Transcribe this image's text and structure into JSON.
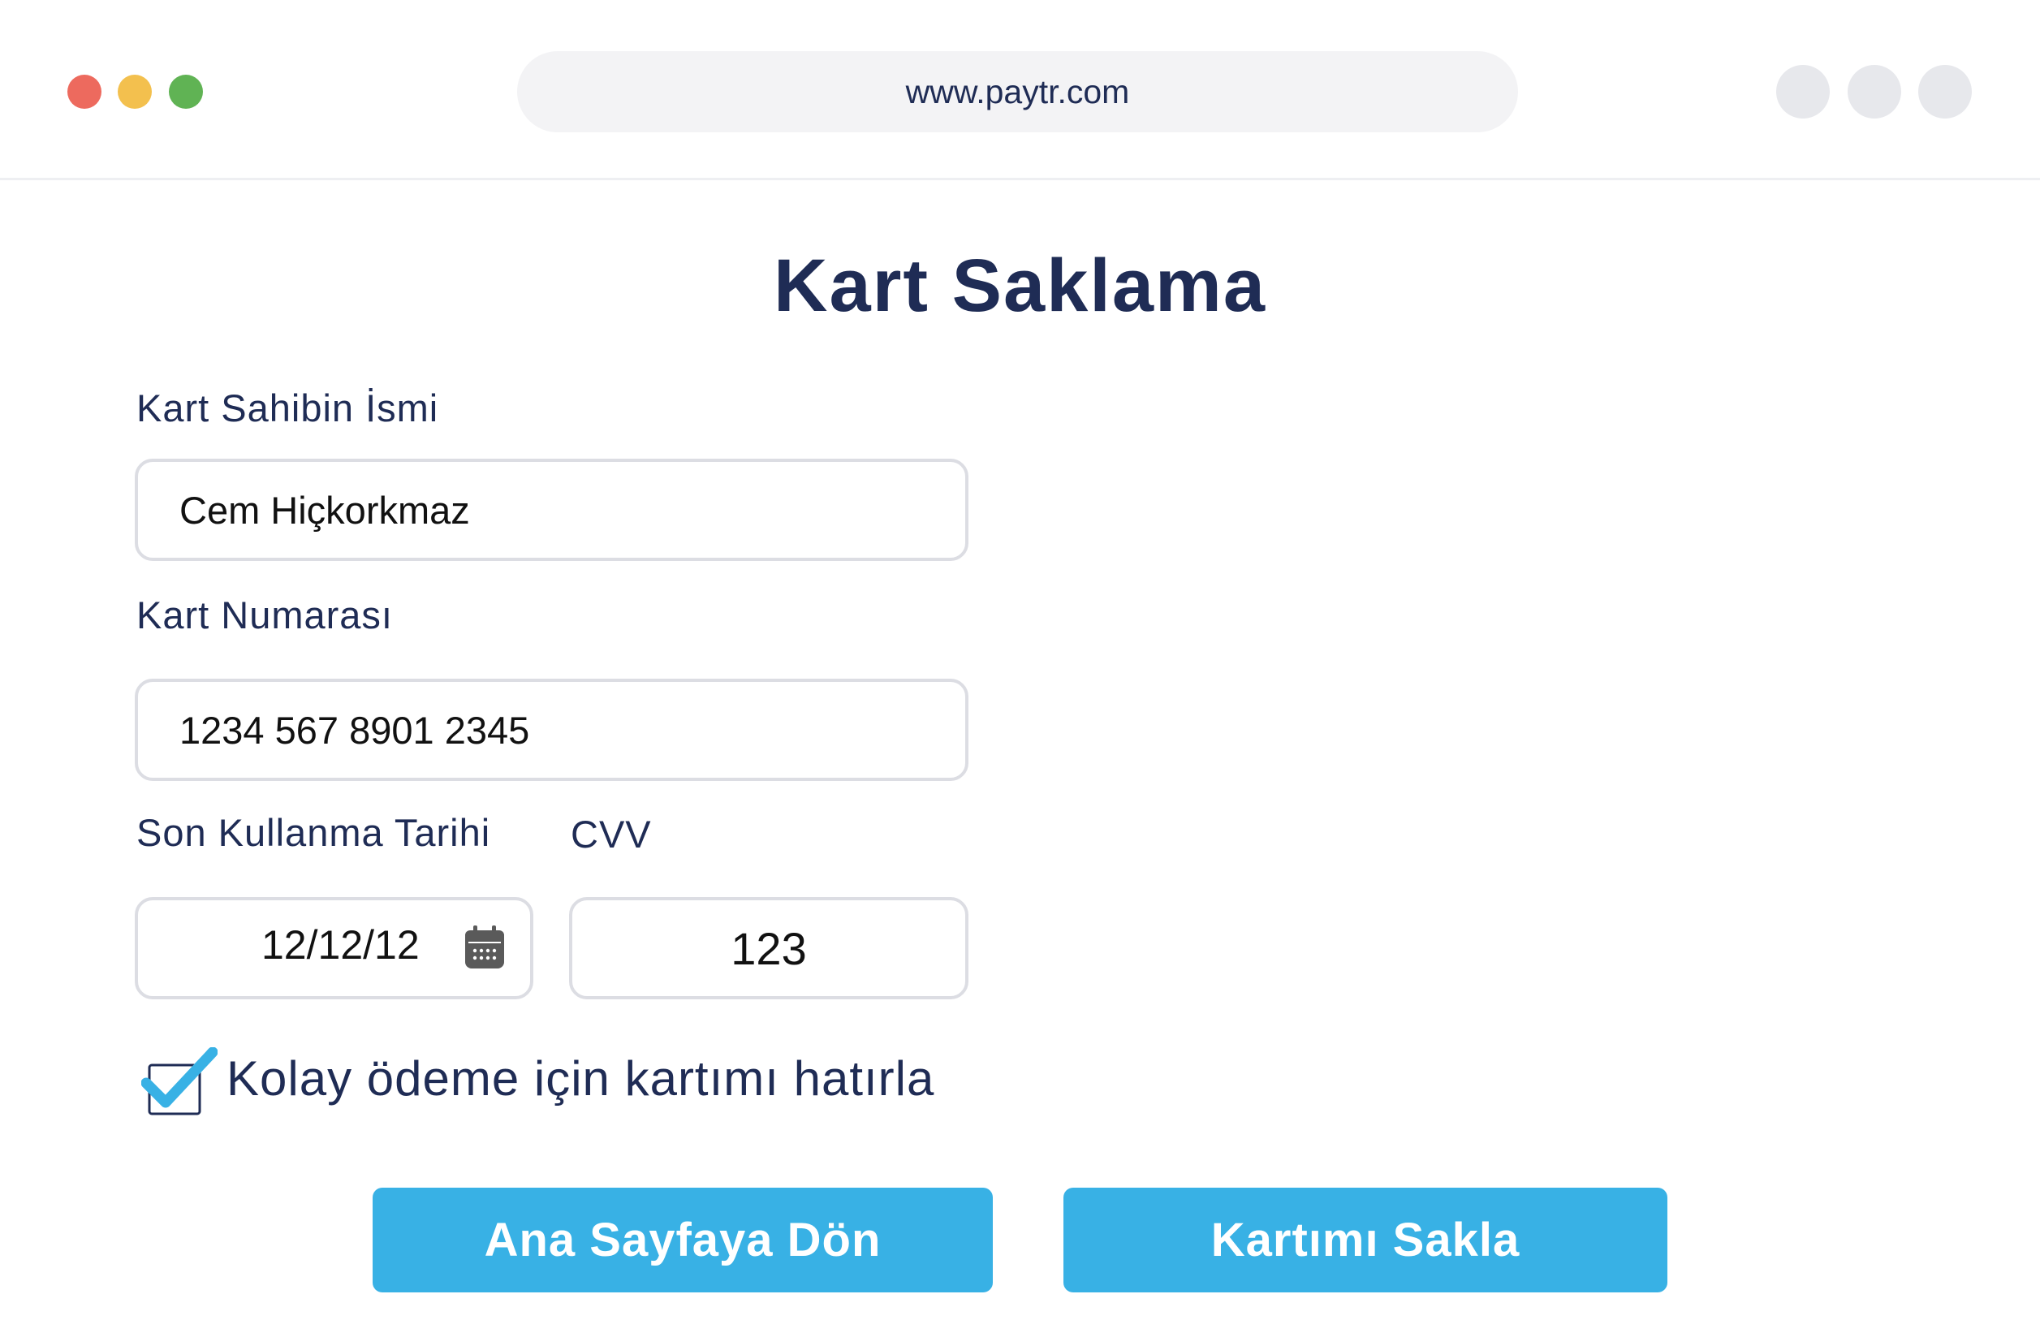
{
  "browser": {
    "url": "www.paytr.com"
  },
  "page": {
    "title": "Kart Saklama"
  },
  "form": {
    "name_label": "Kart Sahibin İsmi",
    "name_value": "Cem Hiçkorkmaz",
    "number_label": "Kart Numarası",
    "number_value": "1234 567 8901 2345",
    "expiry_label": "Son Kullanma Tarihi",
    "expiry_value": "12/12/12",
    "cvv_label": "CVV",
    "cvv_value": "123",
    "remember_label": "Kolay ödeme için kartımı hatırla",
    "remember_checked": true
  },
  "buttons": {
    "back_label": "Ana Sayfaya Dön",
    "save_label": "Kartımı Sakla"
  },
  "colors": {
    "accent": "#38b1e5",
    "text_dark": "#1f2c55",
    "dot_red": "#ed6a5e",
    "dot_yellow": "#f3c04e",
    "dot_green": "#60b354"
  },
  "icons": {
    "calendar": "calendar-icon",
    "checkbox": "checkbox-checked-icon"
  }
}
